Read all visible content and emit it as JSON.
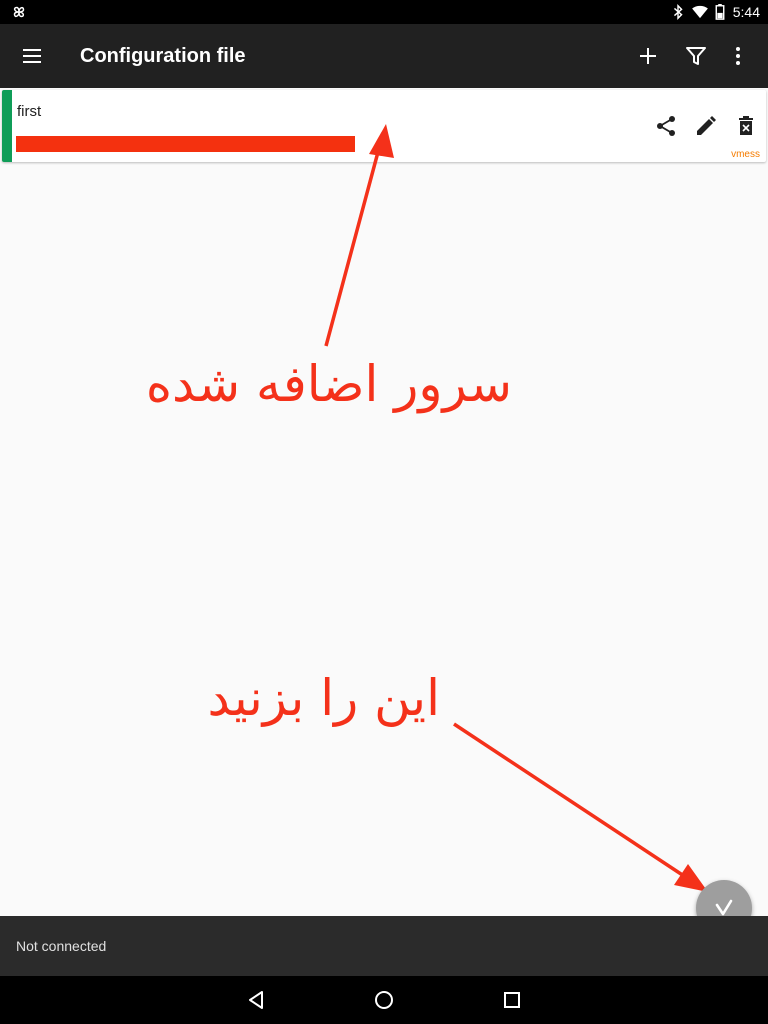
{
  "status_bar": {
    "time": "5:44",
    "icons": [
      "pinwheel-icon",
      "bluetooth-icon",
      "wifi-icon",
      "battery-icon"
    ]
  },
  "toolbar": {
    "title": "Configuration file",
    "menu_icon": "hamburger-menu-icon",
    "actions": [
      "add-icon",
      "filter-icon",
      "more-vert-icon"
    ]
  },
  "servers": [
    {
      "name": "first",
      "type": "vmess",
      "accent_color": "#0f9d58",
      "actions": [
        "share-icon",
        "edit-icon",
        "delete-icon"
      ]
    }
  ],
  "annotations": {
    "added_server": "سرور اضافه شده",
    "tap_this": "این را بزنید",
    "color": "#f4311a"
  },
  "fab": {
    "icon": "v-connect-icon"
  },
  "connection": {
    "status": "Not connected"
  },
  "navigation": [
    "back-icon",
    "home-icon",
    "recents-icon"
  ],
  "colors": {
    "toolbar": "#212121",
    "redaction": "#f4310f",
    "vmess_label": "#f57c00",
    "fab": "#9e9e9e"
  }
}
